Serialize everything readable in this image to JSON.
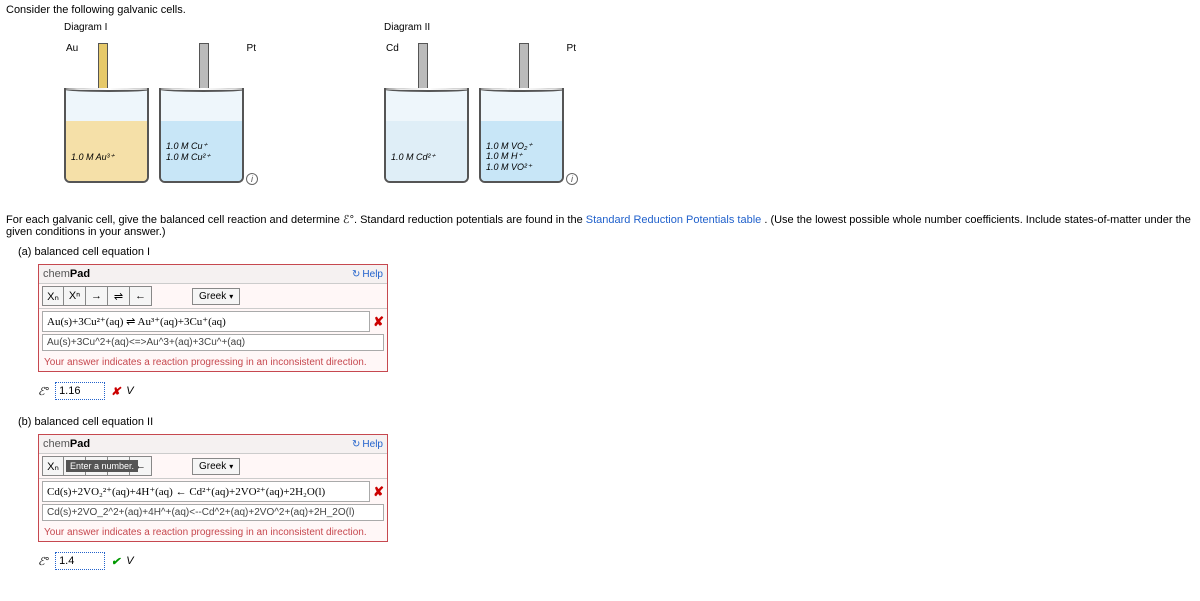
{
  "prompt": "Consider the following galvanic cells.",
  "diagrams": {
    "d1": {
      "label": "Diagram I",
      "left_el": "Au",
      "right_el": "Pt",
      "left_conc": "1.0 M Au³⁺",
      "right_conc_line1": "1.0 M Cu⁺",
      "right_conc_line2": "1.0 M Cu²⁺"
    },
    "d2": {
      "label": "Diagram II",
      "left_el": "Cd",
      "right_el": "Pt",
      "left_conc": "1.0 M Cd²⁺",
      "right_conc_line1": "1.0 M VO₂⁺",
      "right_conc_line2": "1.0 M H⁺",
      "right_conc_line3": "1.0 M VO²⁺"
    }
  },
  "instruction_pre": "For each galvanic cell, give the balanced cell reaction and determine ℰ°. Standard reduction potentials are found in the ",
  "instruction_link": "Standard Reduction Potentials table",
  "instruction_post": ". (Use the lowest possible whole number coefficients. Include states-of-matter under the given conditions in your answer.)",
  "part_a": "(a)  balanced cell equation I",
  "part_b": "(b)  balanced cell equation II",
  "chempad_title_a": "chem",
  "chempad_title_b": "Pad",
  "help": "Help",
  "tools": {
    "sub": "Xₙ",
    "sup": "Xⁿ",
    "arrow": "→",
    "equil": "⇌",
    "back": "←"
  },
  "greek": "Greek",
  "pad_a": {
    "rendered": "Au(s)+3Cu²⁺(aq) ⇌ Au³⁺(aq)+3Cu⁺(aq)",
    "raw": "Au(s)+3Cu^2+(aq)<=>Au^3+(aq)+3Cu^+(aq)",
    "feedback": "Your answer indicates a reaction progressing in an inconsistent direction."
  },
  "emf_a": {
    "value": "1.16",
    "unit": "V",
    "symbol": "ℰ°"
  },
  "pad_b": {
    "rendered": "Cd(s)+2VO₂²⁺(aq)+4H⁺(aq) ← Cd²⁺(aq)+2VO²⁺(aq)+2H₂O(l)",
    "raw": "Cd(s)+2VO_2^2+(aq)+4H^+(aq)<--Cd^2+(aq)+2VO^2+(aq)+2H_2O(l)",
    "feedback": "Your answer indicates a reaction progressing in an inconsistent direction.",
    "placeholder": "Enter a number."
  },
  "emf_b": {
    "value": "1.4",
    "unit": "V",
    "symbol": "ℰ°"
  }
}
